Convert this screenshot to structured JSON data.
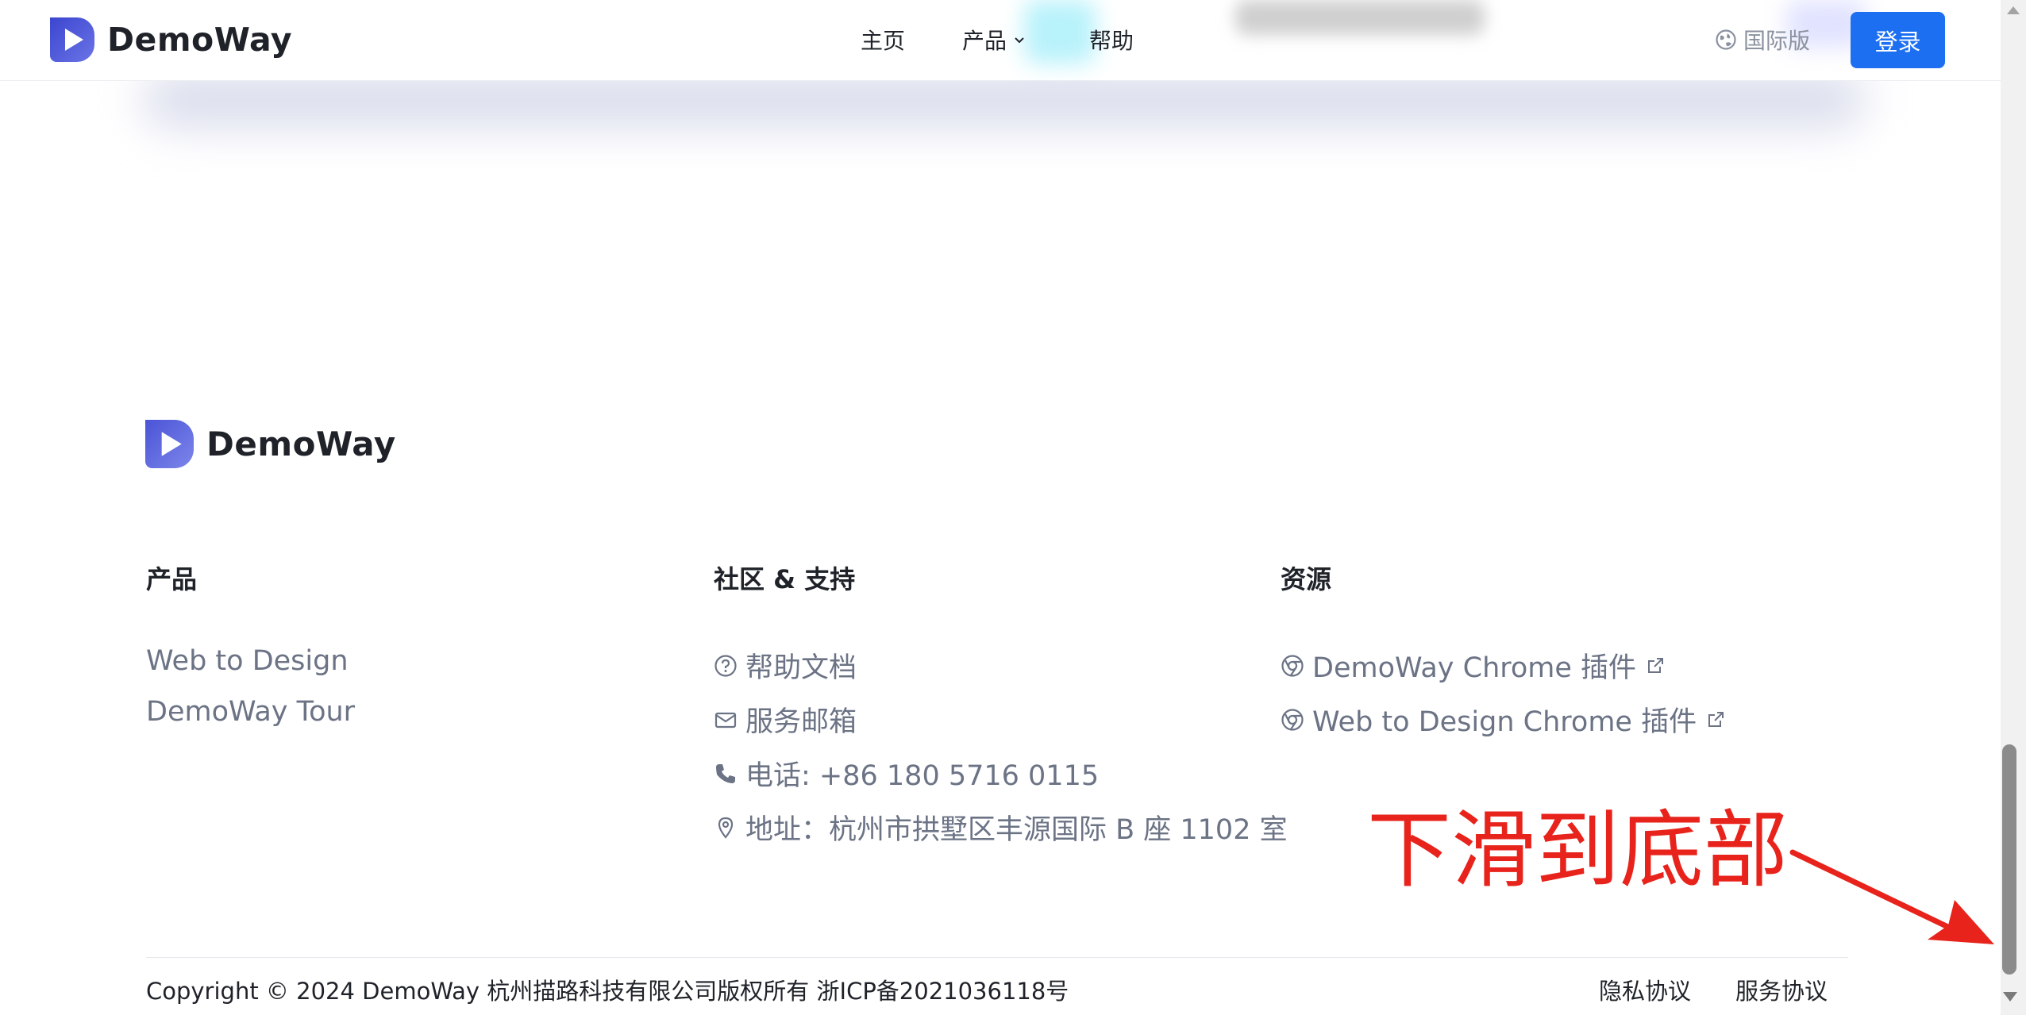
{
  "brand": {
    "name": "DemoWay",
    "color": "#4f5bd5"
  },
  "header": {
    "nav": {
      "home": "主页",
      "products": "产品",
      "help": "帮助"
    },
    "international": "国际版",
    "login": "登录"
  },
  "footer": {
    "columns": [
      {
        "title": "产品",
        "links": [
          "Web to Design",
          "DemoWay Tour"
        ]
      },
      {
        "title": "社区 & 支持",
        "links": [
          {
            "icon": "question-circle-icon",
            "label": "帮助文档"
          },
          {
            "icon": "mail-icon",
            "label": "服务邮箱"
          },
          {
            "icon": "phone-icon",
            "label": "电话: +86 180 5716 0115"
          },
          {
            "icon": "location-pin-icon",
            "label": "地址：杭州市拱墅区丰源国际 B 座 1102 室"
          }
        ]
      },
      {
        "title": "资源",
        "links": [
          {
            "icon": "chrome-icon",
            "label": "DemoWay Chrome 插件"
          },
          {
            "icon": "chrome-icon",
            "label": "Web to Design Chrome 插件"
          }
        ]
      }
    ],
    "copyright": "Copyright © 2024 DemoWay 杭州描路科技有限公司版权所有 浙ICP备2021036118号",
    "legal": {
      "privacy": "隐私协议",
      "terms": "服务协议"
    }
  },
  "annotation": {
    "text": "下滑到底部",
    "color": "#e8231c"
  },
  "accent_color": "#1d6ff2"
}
